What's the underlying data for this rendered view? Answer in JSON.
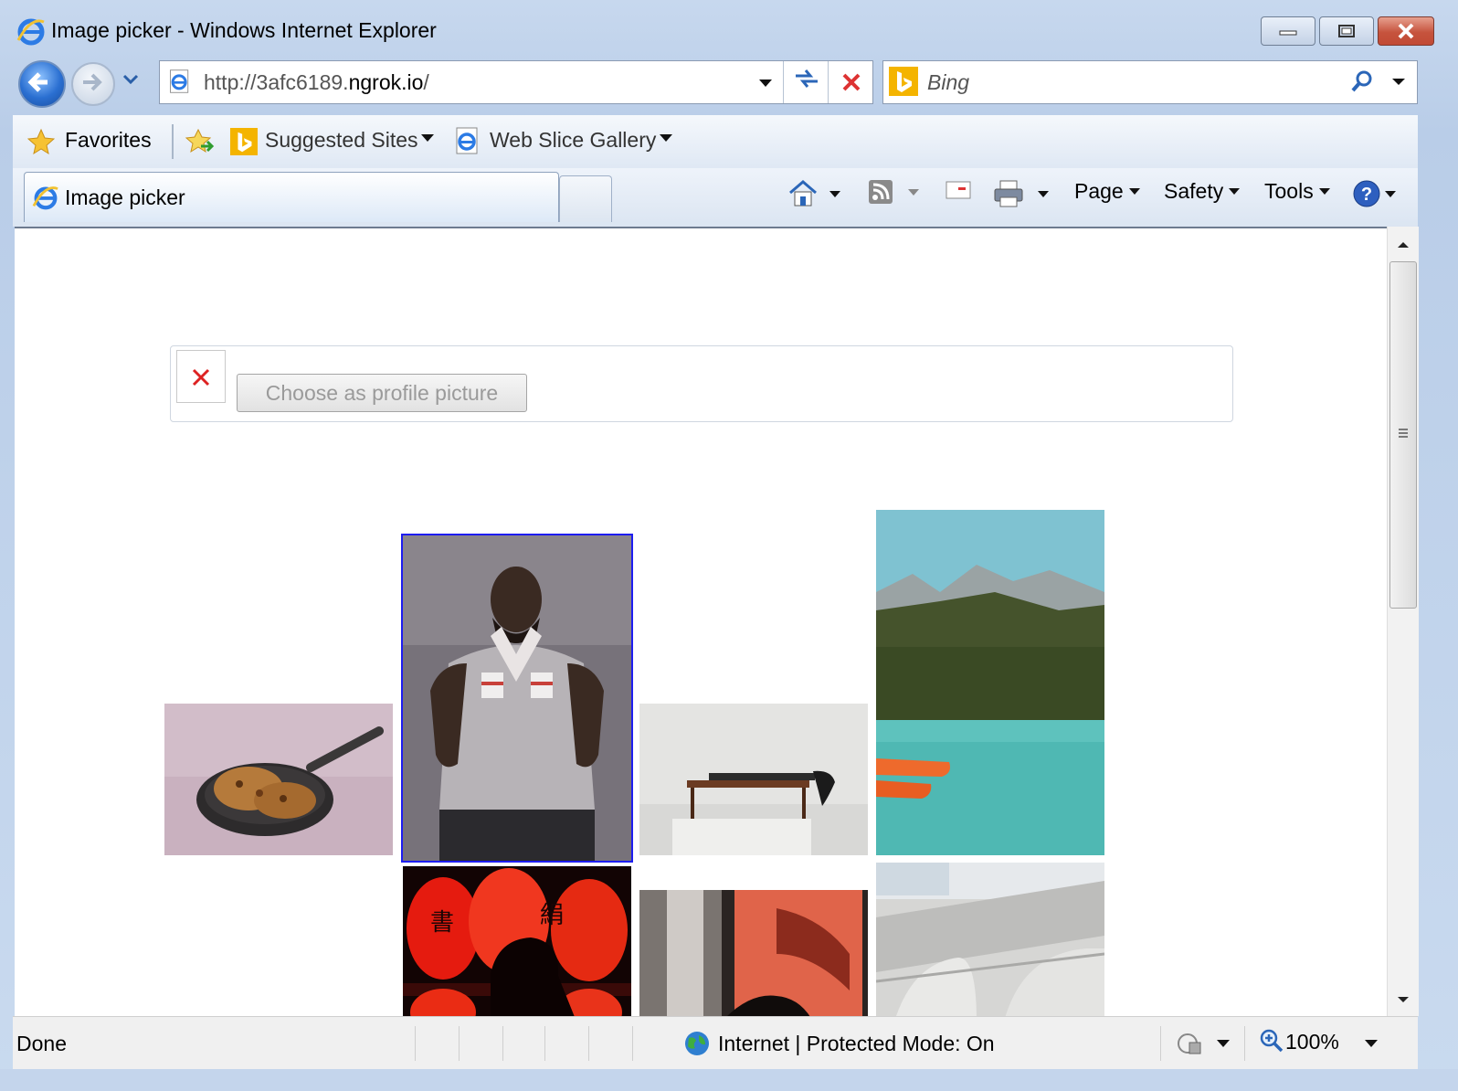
{
  "window": {
    "title": "Image picker - Windows Internet Explorer"
  },
  "nav": {
    "url_prefix": "http://3afc6189.",
    "url_domain": "ngrok.io",
    "url_suffix": "/",
    "search_placeholder": "Bing"
  },
  "favorites_bar": {
    "favorites_label": "Favorites",
    "suggested_label": "Suggested Sites",
    "web_slice_label": "Web Slice Gallery"
  },
  "tab": {
    "label": "Image picker"
  },
  "commands": {
    "page": "Page",
    "safety": "Safety",
    "tools": "Tools"
  },
  "page": {
    "choose_button": "Choose as profile picture",
    "images": [
      {
        "subject": "cookies in a skillet"
      },
      {
        "subject": "man in gray t-shirt",
        "selected": true
      },
      {
        "subject": "person lying on table"
      },
      {
        "subject": "mountain lake with canoes"
      },
      {
        "subject": "red lanterns"
      },
      {
        "subject": "silhouette with orange wall"
      },
      {
        "subject": "concrete structure"
      }
    ]
  },
  "status": {
    "left": "Done",
    "zone": "Internet | Protected Mode: On",
    "zoom": "100%"
  },
  "colors": {
    "accent": "#1d1df0",
    "window_frame": "#c4d5ec"
  }
}
